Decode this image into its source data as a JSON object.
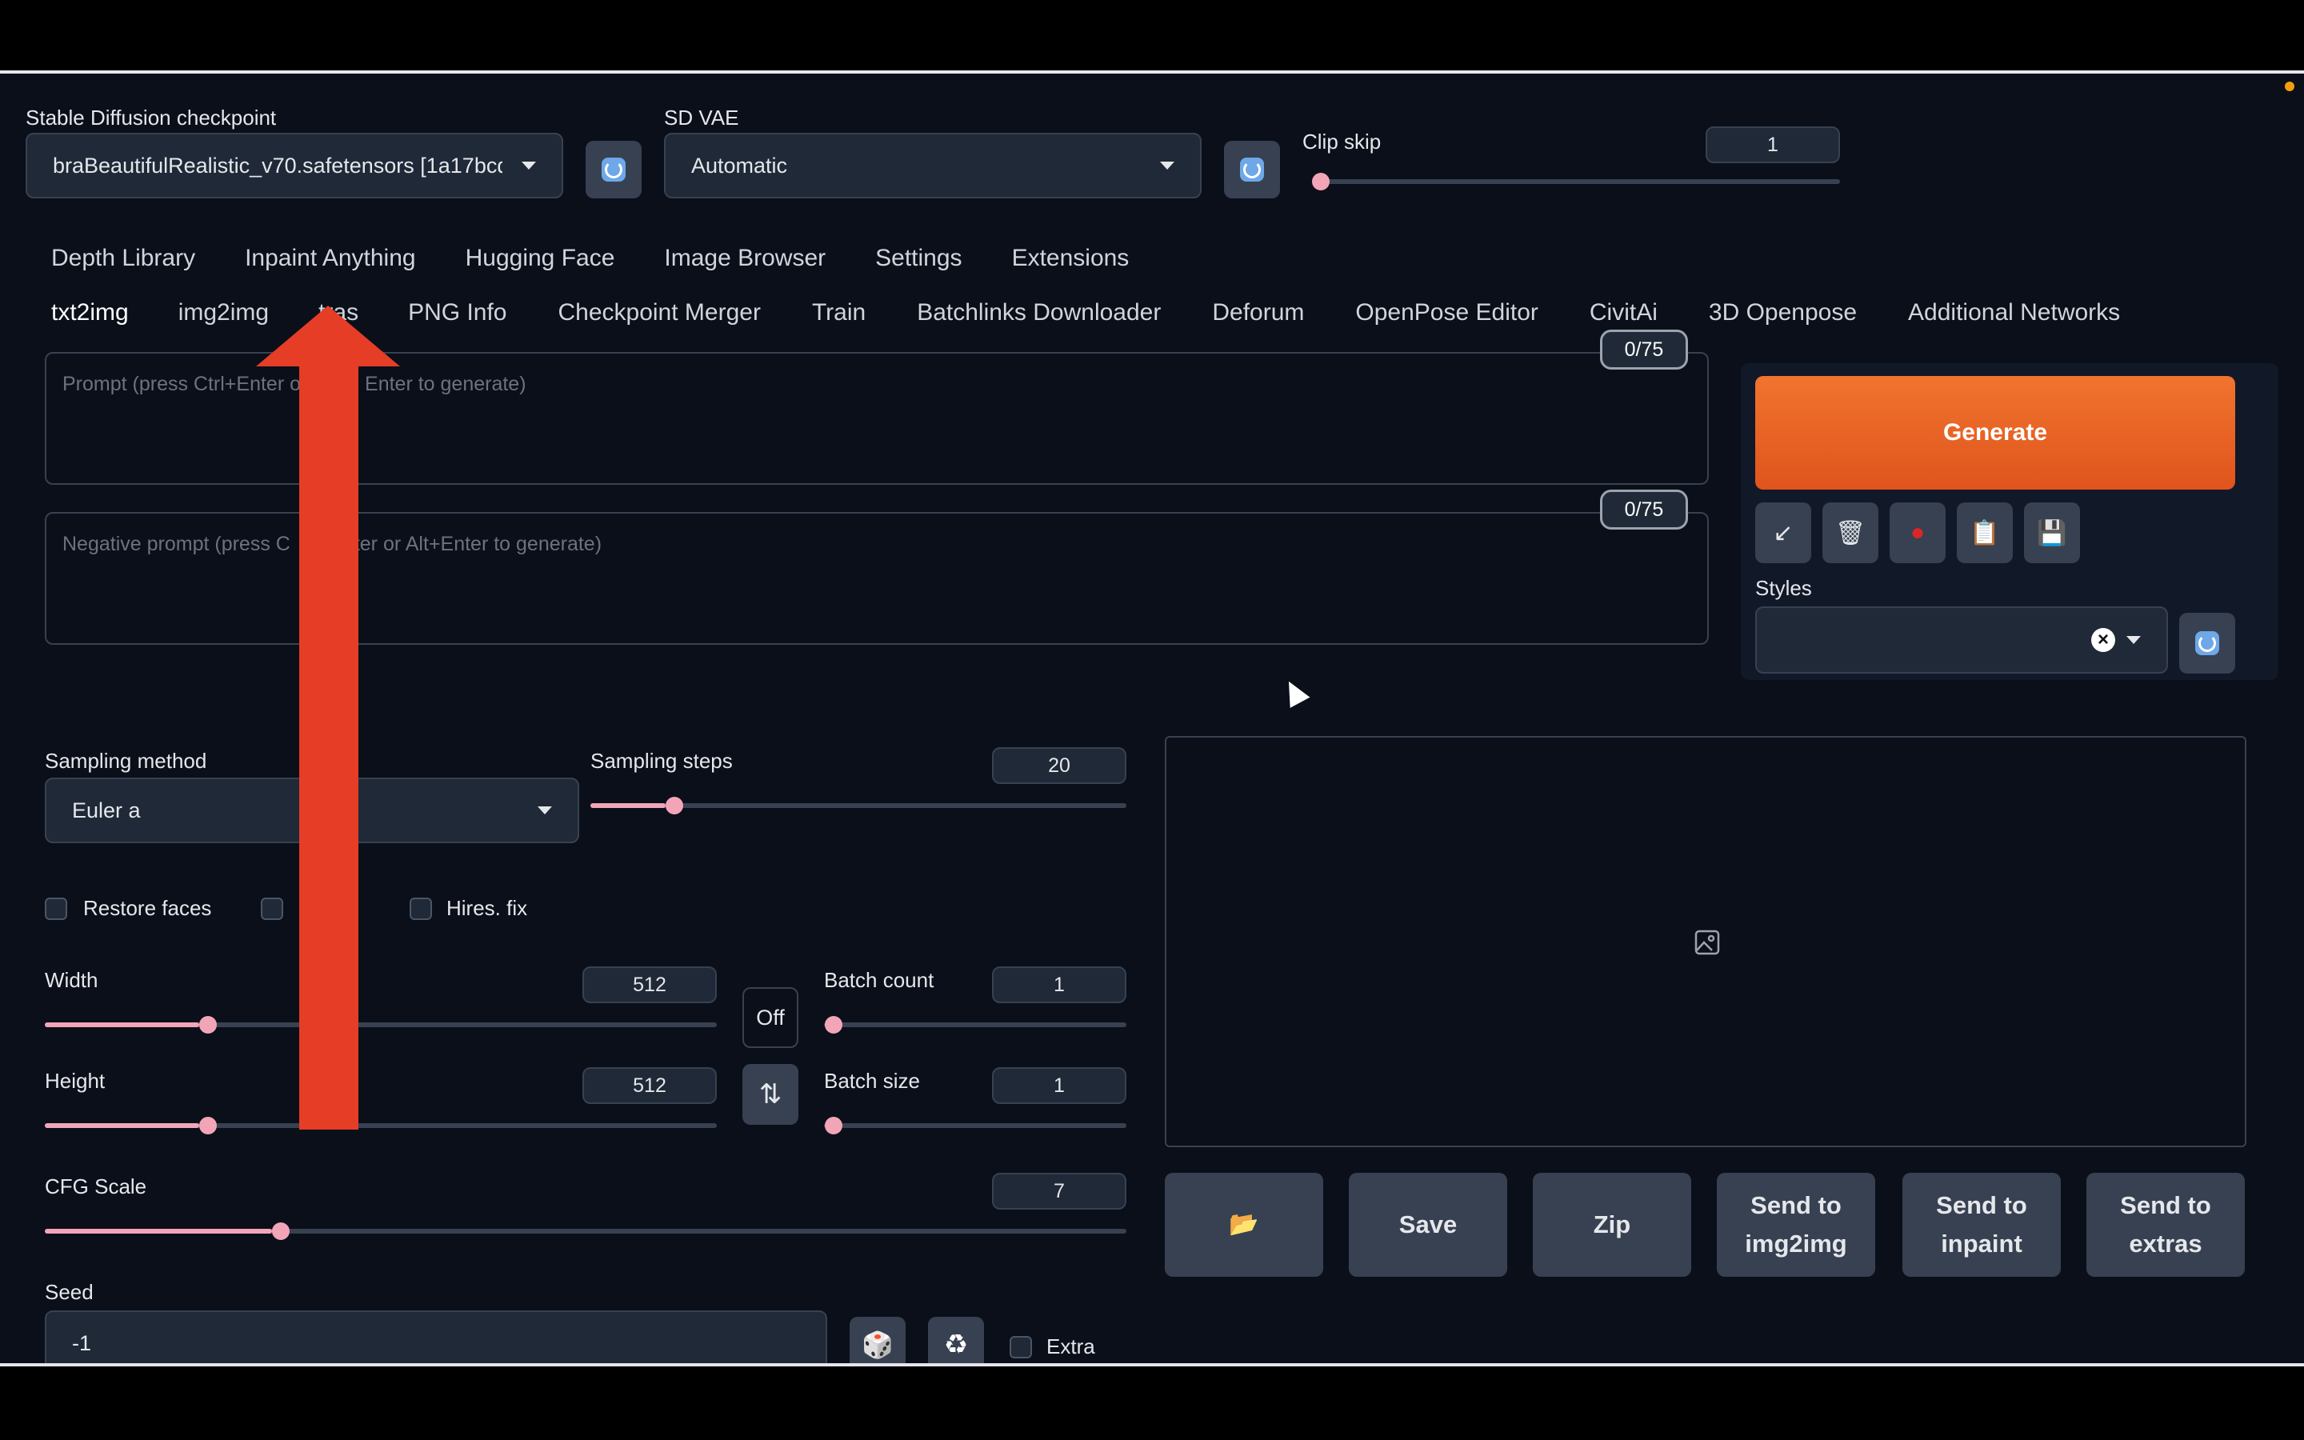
{
  "top": {
    "checkpoint_label": "Stable Diffusion checkpoint",
    "checkpoint_value": "braBeautifulRealistic_v70.safetensors [1a17bcd",
    "vae_label": "SD VAE",
    "vae_value": "Automatic",
    "clip_skip_label": "Clip skip",
    "clip_skip_value": "1",
    "clip_skip_fraction": 0.0
  },
  "tabs_row1": [
    "Depth Library",
    "Inpaint Anything",
    "Hugging Face",
    "Image Browser",
    "Settings",
    "Extensions"
  ],
  "tabs_row2": [
    "txt2img",
    "img2img",
    "Extras",
    "PNG Info",
    "Checkpoint Merger",
    "Train",
    "Batchlinks Downloader",
    "Deforum",
    "OpenPose Editor",
    "CivitAi",
    "3D Openpose",
    "Additional Networks"
  ],
  "tabs_row2_extras_visible": "tras",
  "prompt": {
    "placeholder_left": "Prompt (press Ctrl+Enter o",
    "placeholder_right": "Enter to generate)",
    "counter": "0/75"
  },
  "negative_prompt": {
    "placeholder_left": "Negative prompt (press C",
    "placeholder_right": "ter or Alt+Enter to generate)",
    "counter": "0/75"
  },
  "right": {
    "generate_label": "Generate",
    "tool_icons": [
      "arrow-down-left-icon",
      "trash-icon",
      "red-card-icon",
      "clipboard-icon",
      "save-icon"
    ],
    "tool_glyphs": [
      "↙",
      "🗑",
      "●",
      "📋",
      "💾"
    ],
    "styles_label": "Styles",
    "styles_clear": "×"
  },
  "sampling": {
    "method_label": "Sampling method",
    "method_value": "Euler a",
    "steps_label": "Sampling steps",
    "steps_value": "20",
    "steps_fraction": 0.14
  },
  "checks": {
    "restore_faces": "Restore faces",
    "hires_fix": "Hires. fix"
  },
  "size": {
    "width_label": "Width",
    "width_value": "512",
    "width_fraction": 0.23,
    "height_label": "Height",
    "height_value": "512",
    "height_fraction": 0.23,
    "off_label": "Off",
    "swap_glyph": "⇅",
    "batch_count_label": "Batch count",
    "batch_count_value": "1",
    "batch_size_label": "Batch size",
    "batch_size_value": "1"
  },
  "cfg": {
    "label": "CFG Scale",
    "value": "7",
    "fraction": 0.21
  },
  "seed": {
    "label": "Seed",
    "value": "-1",
    "extra_label": "Extra",
    "dice_glyph": "🎲",
    "recycle_glyph": "♻"
  },
  "output_buttons": {
    "folder_glyph": "📂",
    "save": "Save",
    "zip": "Zip",
    "send_img2img_l1": "Send to",
    "send_img2img_l2": "img2img",
    "send_inpaint_l1": "Send to",
    "send_inpaint_l2": "inpaint",
    "send_extras_l1": "Send to",
    "send_extras_l2": "extras"
  },
  "colors": {
    "background": "#0b0f19",
    "generate": "#e0541d",
    "slider": "#f3a5b8",
    "annotation_arrow": "#e53d26"
  }
}
